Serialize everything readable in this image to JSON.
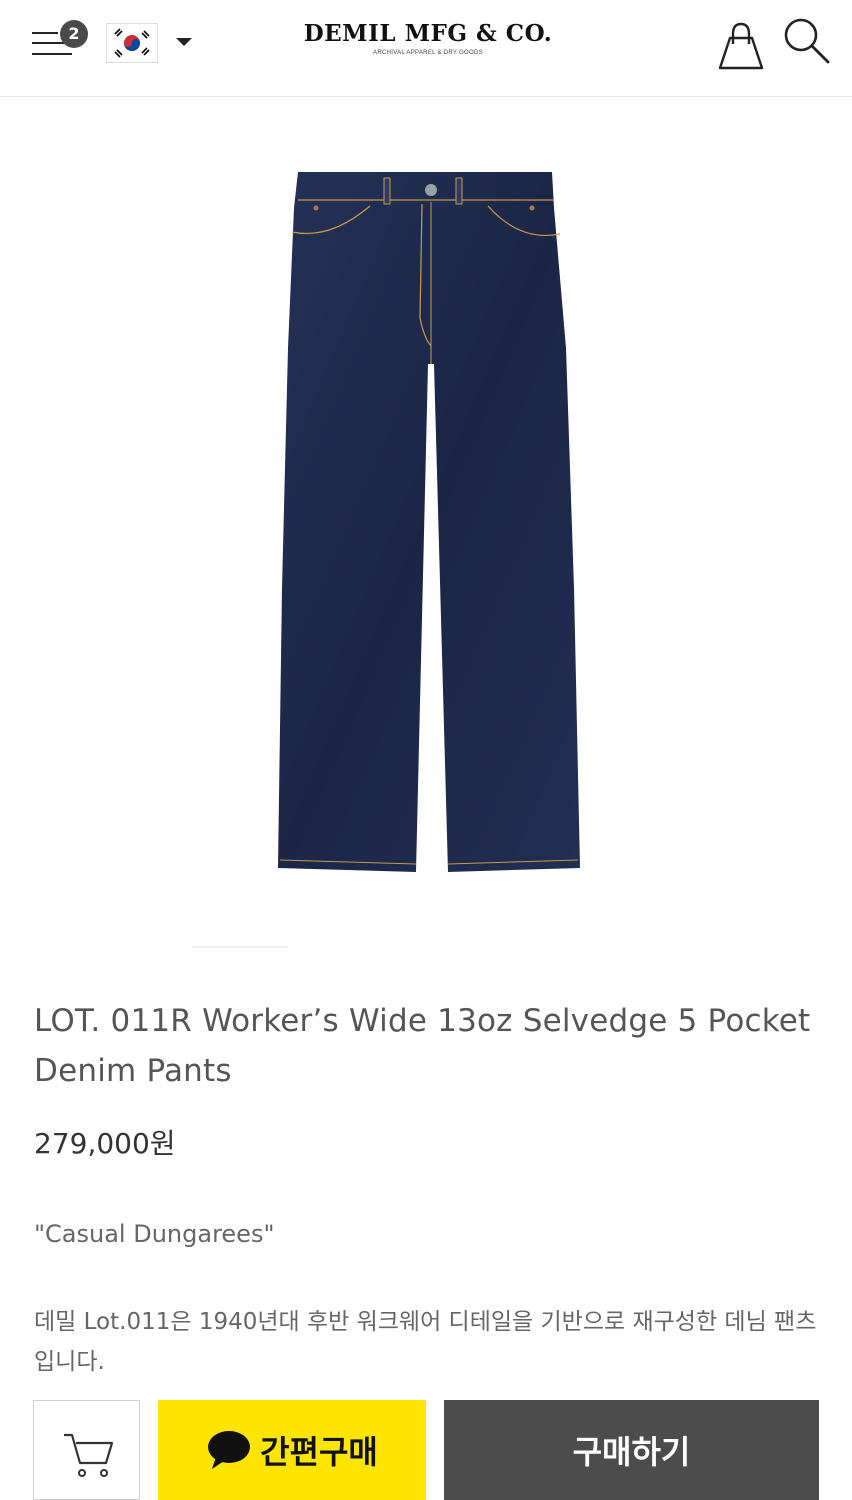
{
  "header": {
    "menu_badge_count": "2",
    "language_flag": "korea-flag-icon",
    "logo_title": "DEMIL MFG & CO.",
    "logo_subtitle": "ARCHIVAL APPAREL & DRY GOODS"
  },
  "product": {
    "title": "LOT. 011R Worker’s Wide 13oz Selvedge 5 Pocket Denim Pants",
    "price": "279,000원",
    "tagline": "\"Casual Dungarees\"",
    "description": "데밀 Lot.011은 1940년대 후반 워크웨어 디테일을 기반으로 재구성한 데님 팬츠입니다."
  },
  "bottom_bar": {
    "kakao_label": "간편구매",
    "buy_label": "구매하기"
  },
  "colors": {
    "kakao_yellow": "#fee500",
    "buy_button": "#4c4c4c",
    "denim": "#1e2a4c"
  }
}
